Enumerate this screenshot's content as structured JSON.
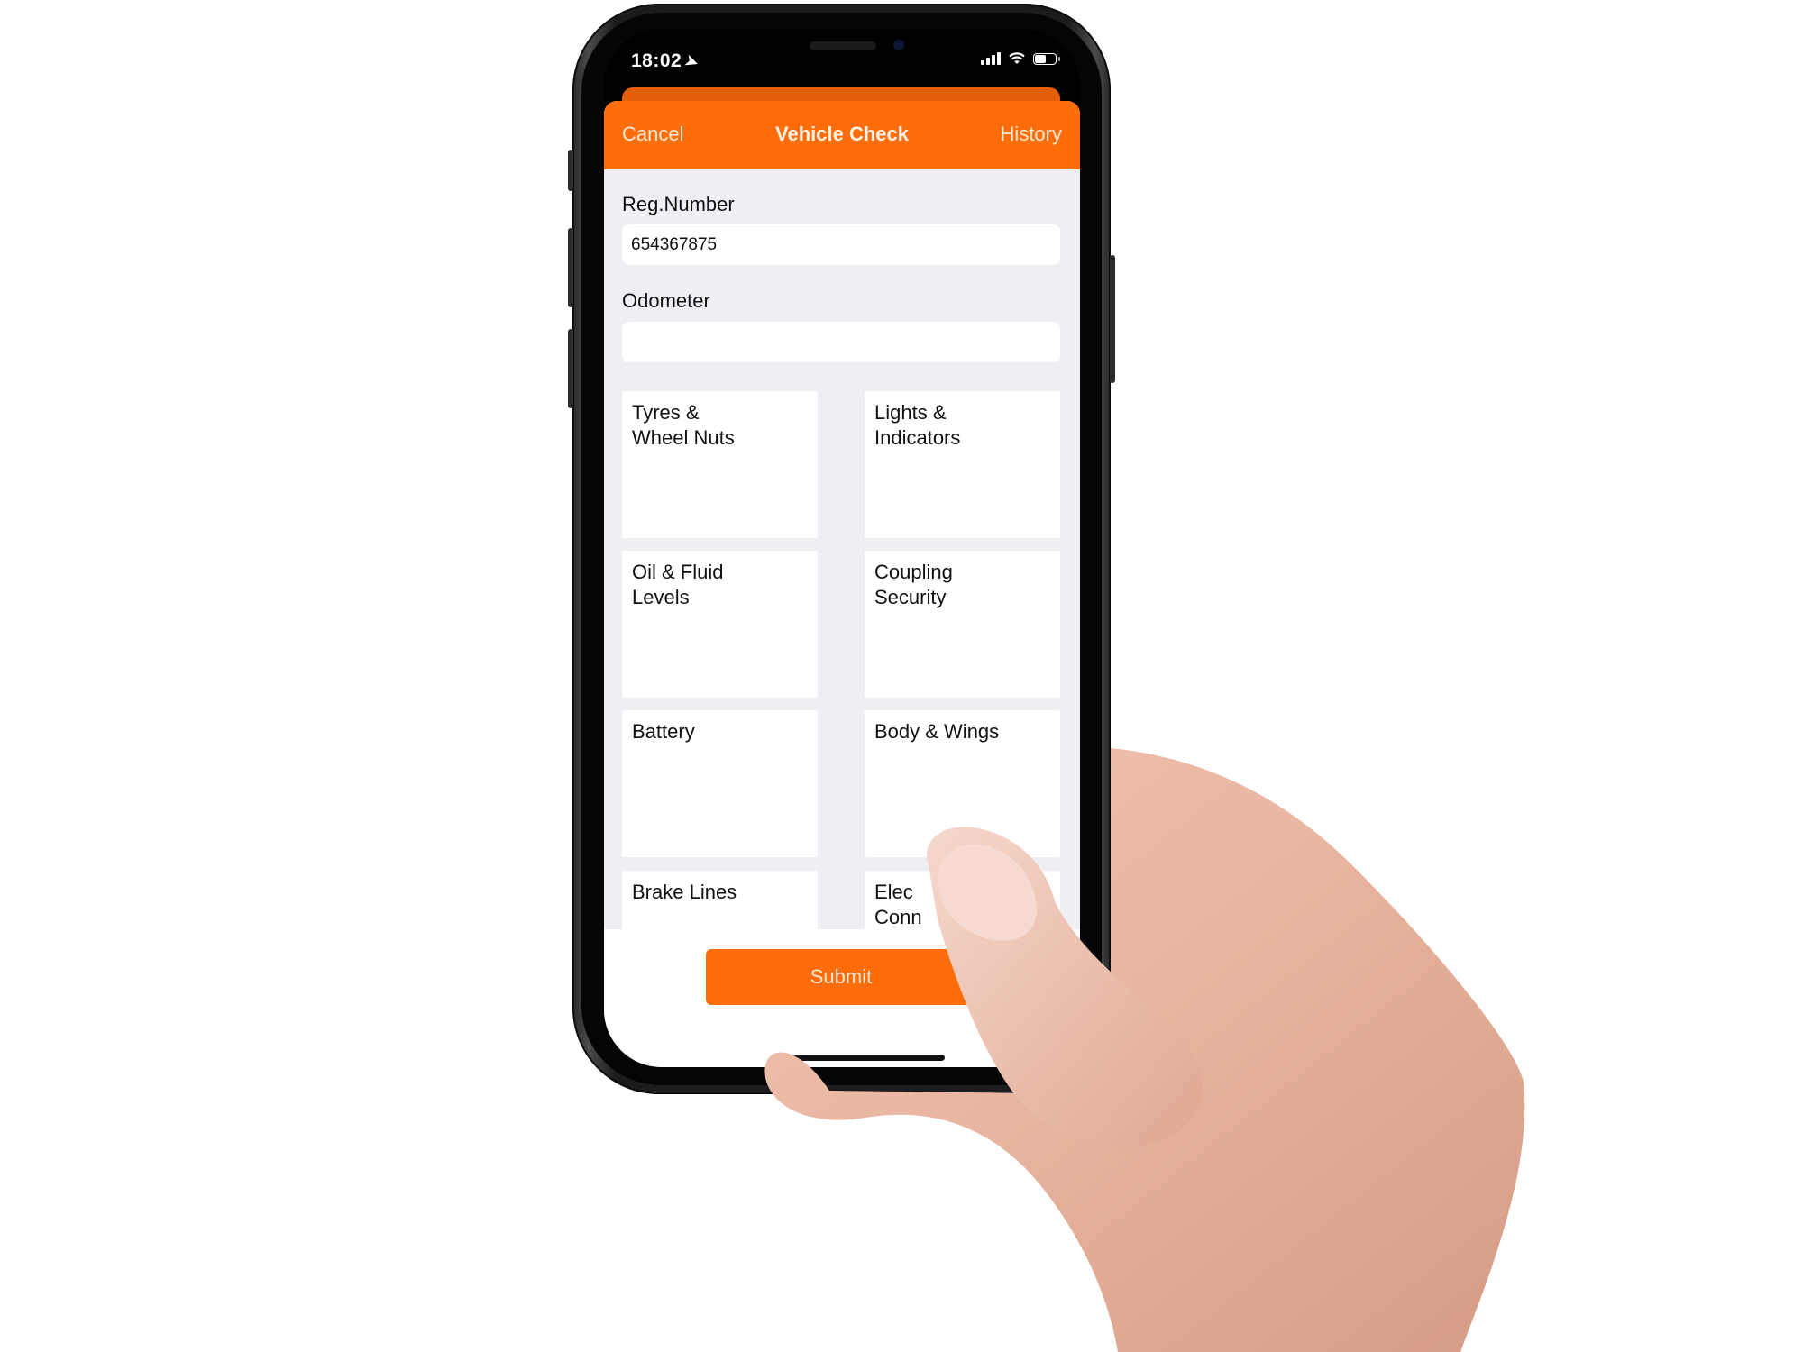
{
  "status_bar": {
    "time": "18:02",
    "location_icon": "location-arrow-icon",
    "signal_icon": "cellular-signal-icon",
    "wifi_icon": "wifi-icon",
    "battery_icon": "battery-icon",
    "battery_level": 0.55
  },
  "navbar": {
    "cancel_label": "Cancel",
    "title": "Vehicle Check",
    "history_label": "History",
    "accent_color": "#ff6c0a"
  },
  "form": {
    "reg_number": {
      "label": "Reg.Number",
      "value": "654367875",
      "placeholder": ""
    },
    "odometer": {
      "label": "Odometer",
      "value": "",
      "placeholder": ""
    }
  },
  "checks": [
    {
      "line1": "Tyres &",
      "line2": "Wheel Nuts"
    },
    {
      "line1": "Lights &",
      "line2": "Indicators"
    },
    {
      "line1": "Oil & Fluid",
      "line2": "Levels"
    },
    {
      "line1": "Coupling",
      "line2": "Security"
    },
    {
      "line1": "Battery",
      "line2": ""
    },
    {
      "line1": "Body & Wings",
      "line2": ""
    },
    {
      "line1": "Brake Lines",
      "line2": ""
    },
    {
      "line1": "Elec",
      "line2": "Conn"
    }
  ],
  "submit_label": "Submit"
}
